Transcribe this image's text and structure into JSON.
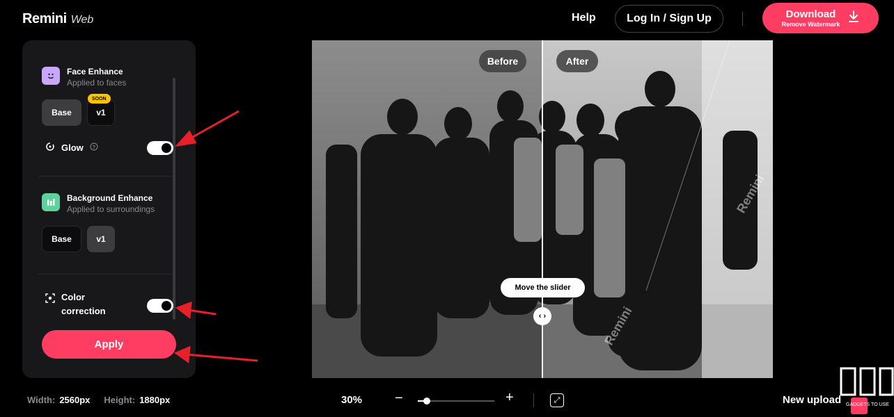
{
  "header": {
    "logo_main": "Remini",
    "logo_sub": "Web",
    "help": "Help",
    "login": "Log In / Sign Up",
    "download_main": "Download",
    "download_sub": "Remove Watermark"
  },
  "panel": {
    "face": {
      "title": "Face Enhance",
      "subtitle": "Applied to faces",
      "options": [
        "Base",
        "v1"
      ],
      "soon_badge": "SOON",
      "glow_label": "Glow",
      "glow_on": true
    },
    "background": {
      "title": "Background Enhance",
      "subtitle": "Applied to surroundings",
      "options": [
        "Base",
        "v1"
      ]
    },
    "color_correction_label_1": "Color",
    "color_correction_label_2": "correction",
    "color_correction_on": true,
    "apply": "Apply"
  },
  "viewer": {
    "before": "Before",
    "after": "After",
    "slider_tip": "Move the slider",
    "slider_handle": "‹ ›",
    "watermark": "Remini"
  },
  "footer": {
    "width_label": "Width:",
    "width_value": "2560px",
    "height_label": "Height:",
    "height_value": "1880px",
    "zoom": "30%",
    "zoom_fraction": 0.12,
    "minus": "−",
    "plus": "+",
    "new_upload": "New upload",
    "corner_logo_text": "GADGETS TO USE"
  },
  "colors": {
    "accent": "#ff3d63",
    "soon_badge": "#ffc300",
    "panel_bg": "#18181a",
    "annotation_arrow": "#e8202a"
  }
}
